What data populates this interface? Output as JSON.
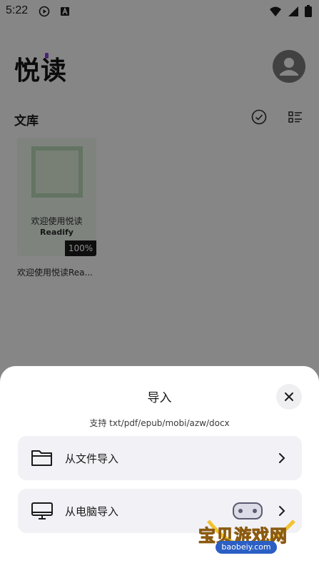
{
  "status_bar": {
    "time": "5:22",
    "icons": [
      "play-icon",
      "a-icon",
      "wifi-icon",
      "signal-icon",
      "battery-icon"
    ]
  },
  "header": {
    "app_name": "悦读",
    "avatar_icon": "user-avatar-icon"
  },
  "library": {
    "title": "文库",
    "actions": [
      "check-circle-icon",
      "list-view-icon"
    ]
  },
  "books": [
    {
      "cover_title": "欢迎使用悦读",
      "cover_subtitle": "Readify",
      "progress": "100%",
      "name": "欢迎使用悦读Rea..."
    }
  ],
  "import_sheet": {
    "title": "导入",
    "subtitle": "支持 txt/pdf/epub/mobi/azw/docx",
    "options": [
      {
        "label": "从文件导入",
        "icon": "folder-icon"
      },
      {
        "label": "从电脑导入",
        "icon": "monitor-icon"
      }
    ]
  },
  "watermark": {
    "text": "宝贝游戏网",
    "url": "baobeiy.com"
  },
  "colors": {
    "accent_dot": "#8a3fd9",
    "sheet_bg": "#ffffff",
    "option_bg": "#f1f1f6"
  }
}
